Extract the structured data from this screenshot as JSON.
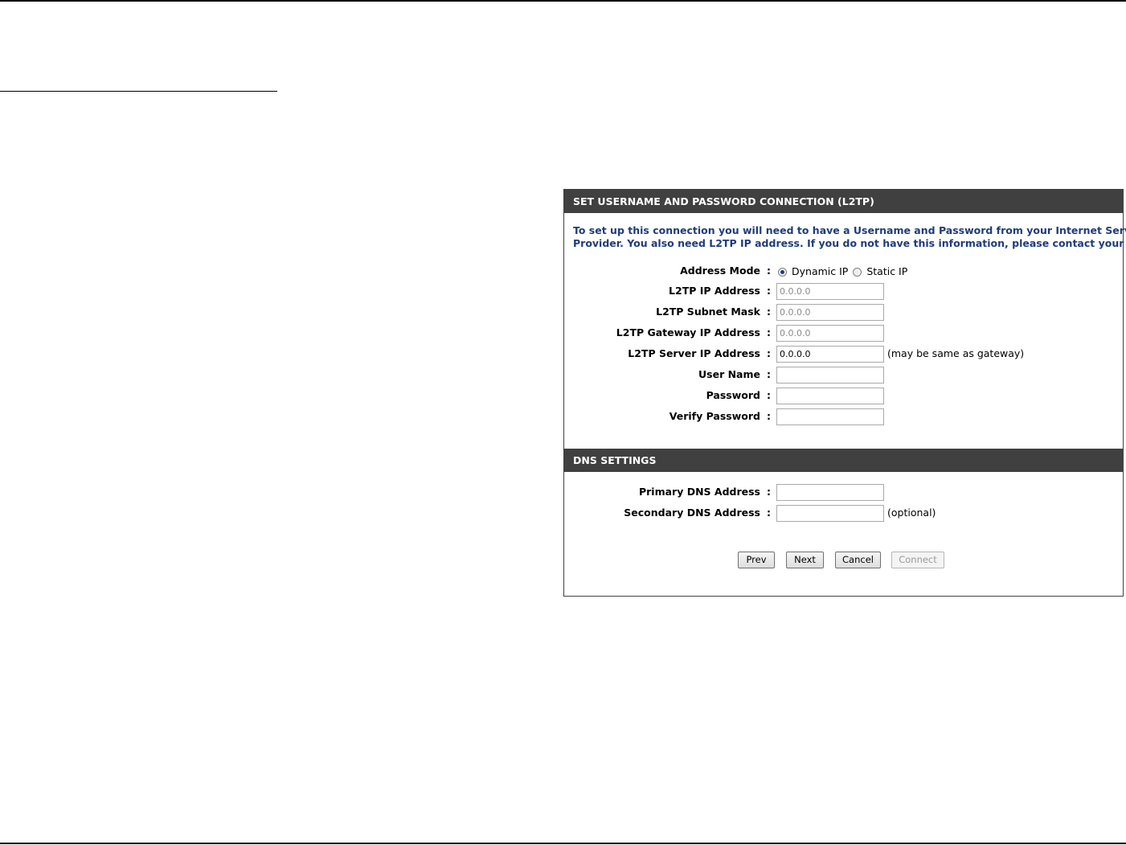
{
  "l2tp_section": {
    "header": "SET USERNAME AND PASSWORD CONNECTION (L2TP)",
    "intro_line1": "To set up this connection you will need to have a Username and Password from your Internet Service",
    "intro_line2": "Provider. You also need L2TP IP address. If you do not have this information, please contact your ISP.",
    "address_mode": {
      "label": "Address Mode",
      "options": [
        "Dynamic IP",
        "Static IP"
      ],
      "selected": "Dynamic IP"
    },
    "fields": {
      "ip_address": {
        "label": "L2TP IP Address",
        "value": "0.0.0.0",
        "disabled": true
      },
      "subnet_mask": {
        "label": "L2TP Subnet Mask",
        "value": "0.0.0.0",
        "disabled": true
      },
      "gateway": {
        "label": "L2TP Gateway IP Address",
        "value": "0.0.0.0",
        "disabled": true
      },
      "server": {
        "label": "L2TP Server IP Address",
        "value": "0.0.0.0",
        "note": "(may be same as gateway)"
      },
      "username": {
        "label": "User Name",
        "value": ""
      },
      "password": {
        "label": "Password",
        "value": ""
      },
      "verify_password": {
        "label": "Verify Password",
        "value": ""
      }
    }
  },
  "dns_section": {
    "header": "DNS SETTINGS",
    "primary": {
      "label": "Primary DNS Address",
      "value": ""
    },
    "secondary": {
      "label": "Secondary DNS Address",
      "value": "",
      "note": "(optional)"
    }
  },
  "buttons": {
    "prev": "Prev",
    "next": "Next",
    "cancel": "Cancel",
    "connect": "Connect"
  },
  "colon": ":",
  "colors": {
    "header_bg": "#404040",
    "intro_text": "#1f3c7a"
  }
}
